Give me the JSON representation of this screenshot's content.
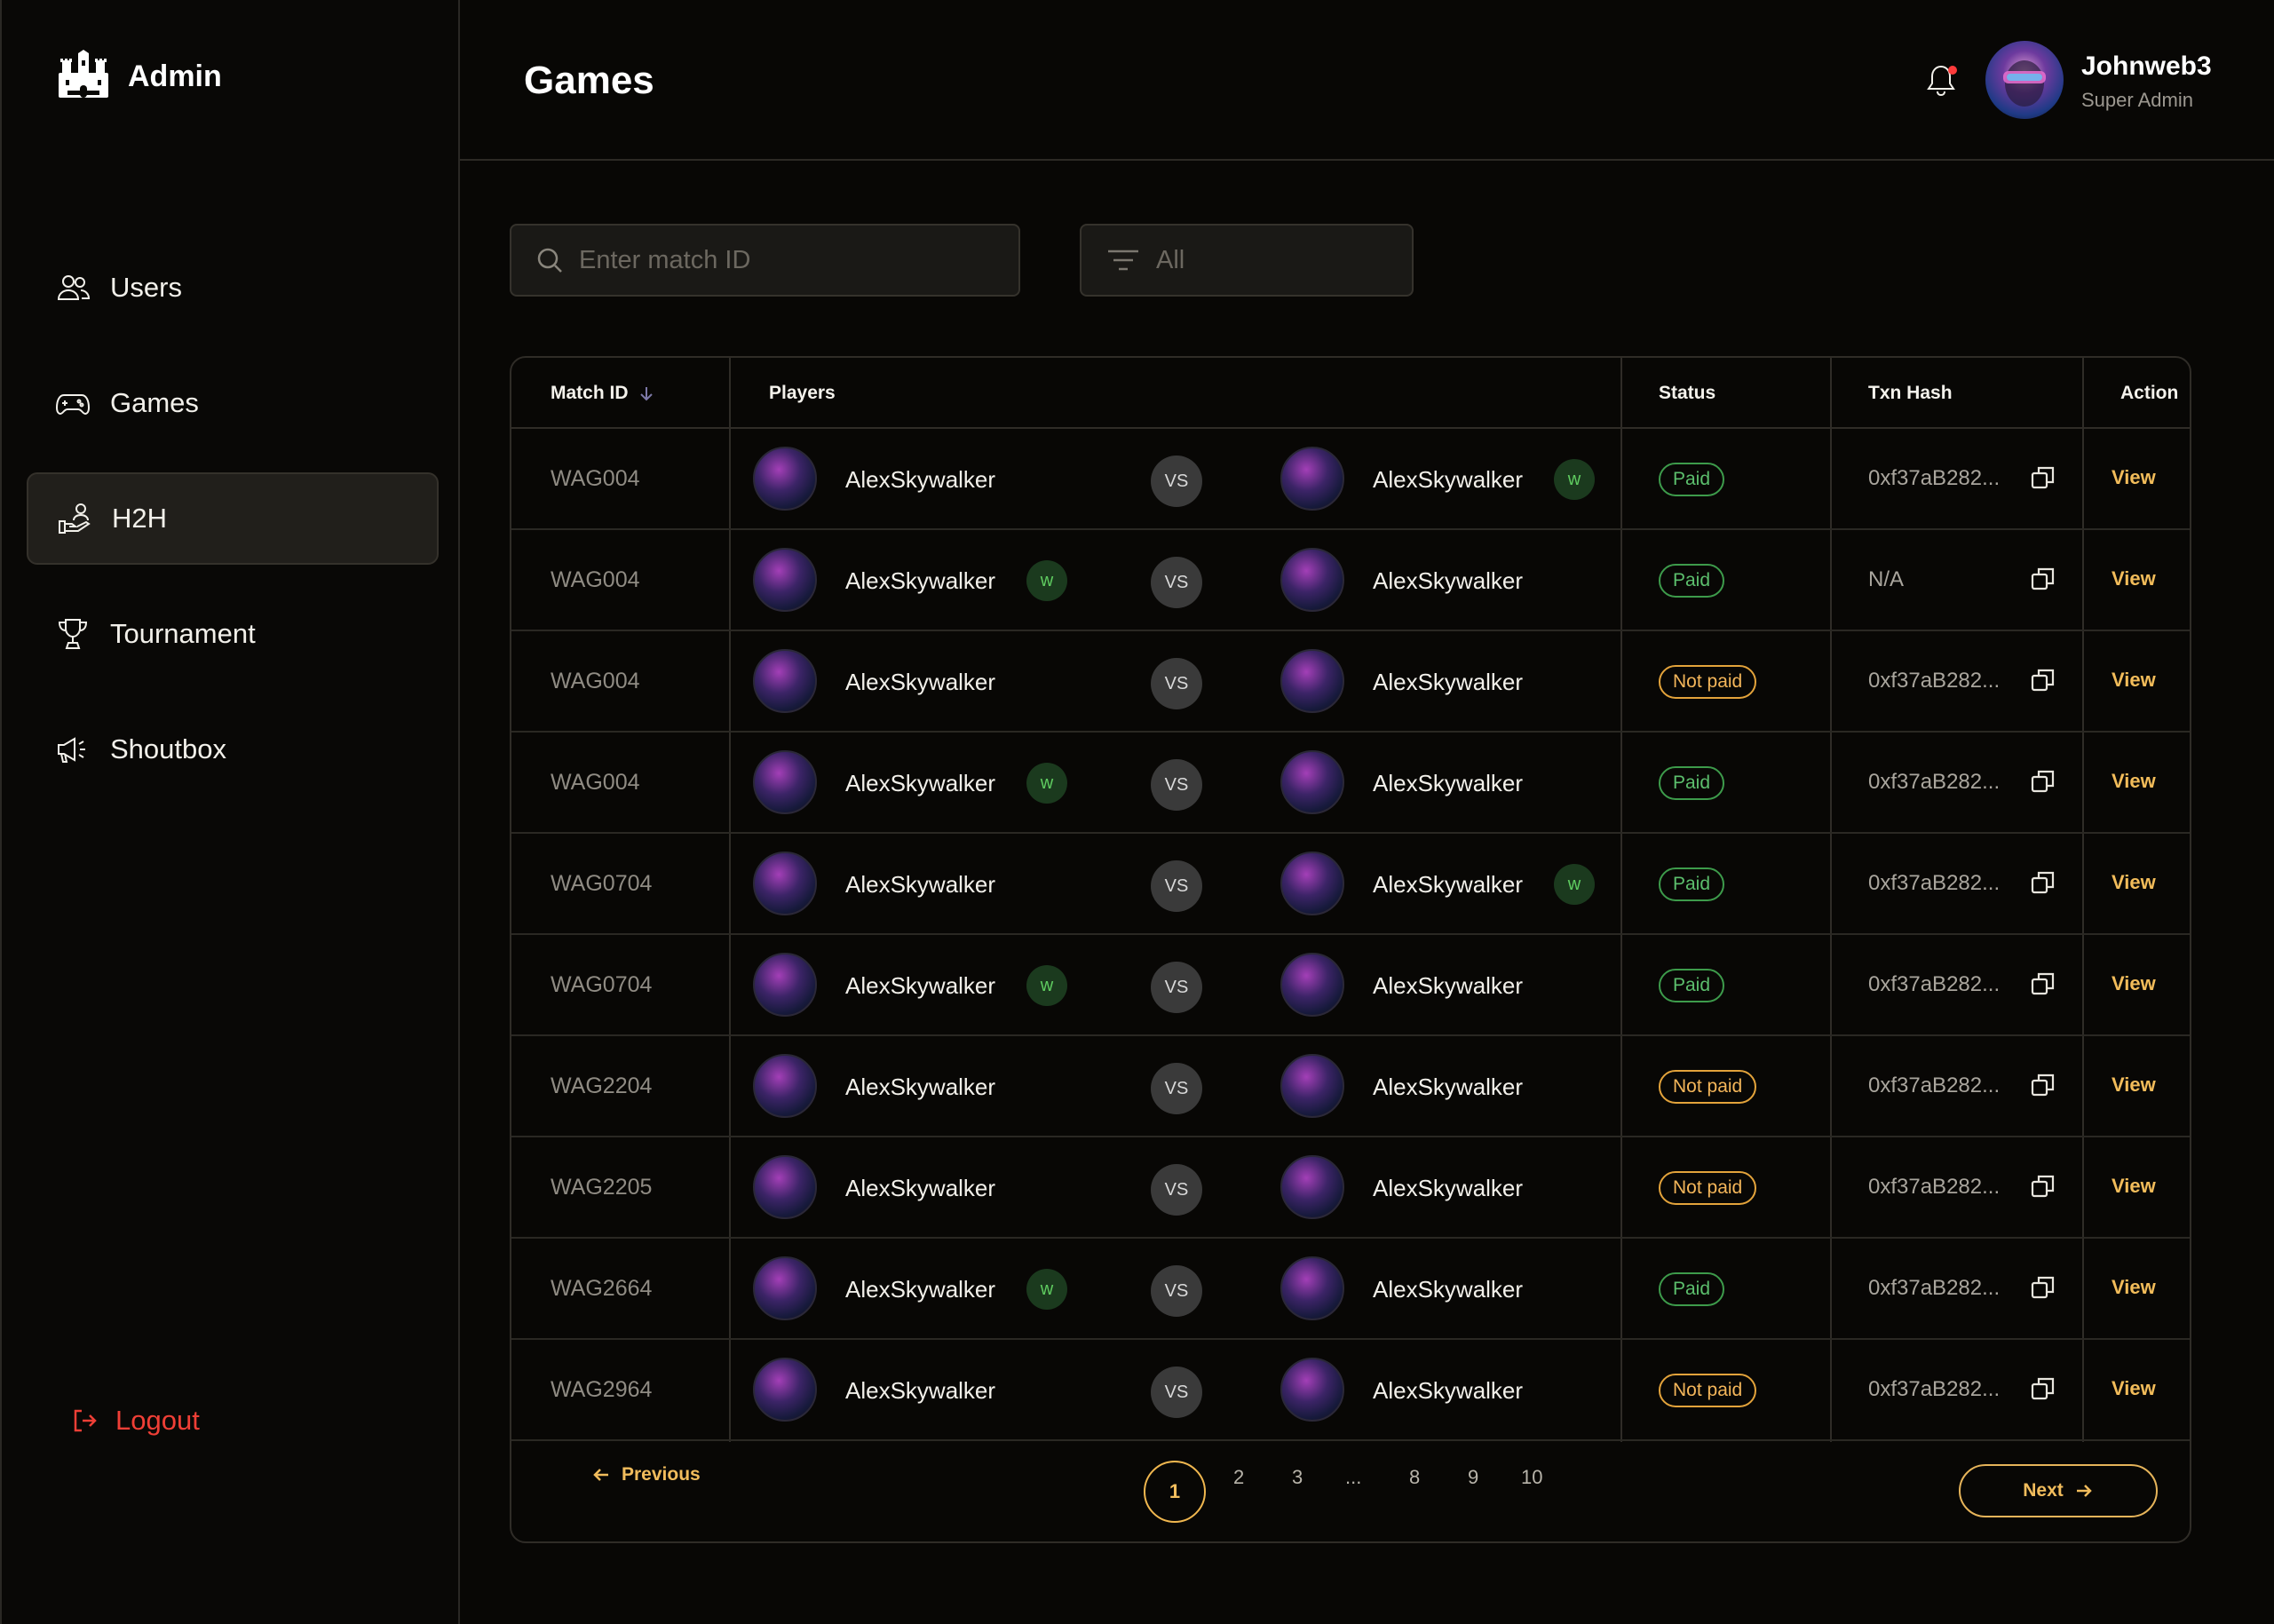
{
  "app": {
    "name": "Admin"
  },
  "header": {
    "title": "Games",
    "user_name": "Johnweb3",
    "user_role": "Super Admin"
  },
  "sidebar": {
    "items": [
      {
        "label": "Users",
        "icon": "users-icon"
      },
      {
        "label": "Games",
        "icon": "gamepad-icon"
      },
      {
        "label": "H2H",
        "icon": "hand-user-icon",
        "active": true
      },
      {
        "label": "Tournament",
        "icon": "trophy-icon"
      },
      {
        "label": "Shoutbox",
        "icon": "megaphone-icon"
      }
    ],
    "logout_label": "Logout"
  },
  "filters": {
    "search_placeholder": "Enter match ID",
    "status_value": "All"
  },
  "table": {
    "columns": [
      "Match ID",
      "Players",
      "Status",
      "Txn Hash",
      "Action"
    ],
    "vs_label": "VS",
    "winner_label": "w",
    "action_label": "View",
    "rows": [
      {
        "id": "WAG004",
        "p1": "AlexSkywalker",
        "p2": "AlexSkywalker",
        "winner": 2,
        "status": "Paid",
        "txn": "0xf37aB282..."
      },
      {
        "id": "WAG004",
        "p1": "AlexSkywalker",
        "p2": "AlexSkywalker",
        "winner": 1,
        "status": "Paid",
        "txn": "N/A"
      },
      {
        "id": "WAG004",
        "p1": "AlexSkywalker",
        "p2": "AlexSkywalker",
        "winner": 0,
        "status": "Not paid",
        "txn": "0xf37aB282..."
      },
      {
        "id": "WAG004",
        "p1": "AlexSkywalker",
        "p2": "AlexSkywalker",
        "winner": 1,
        "status": "Paid",
        "txn": "0xf37aB282..."
      },
      {
        "id": "WAG0704",
        "p1": "AlexSkywalker",
        "p2": "AlexSkywalker",
        "winner": 2,
        "status": "Paid",
        "txn": "0xf37aB282..."
      },
      {
        "id": "WAG0704",
        "p1": "AlexSkywalker",
        "p2": "AlexSkywalker",
        "winner": 1,
        "status": "Paid",
        "txn": "0xf37aB282..."
      },
      {
        "id": "WAG2204",
        "p1": "AlexSkywalker",
        "p2": "AlexSkywalker",
        "winner": 0,
        "status": "Not paid",
        "txn": "0xf37aB282..."
      },
      {
        "id": "WAG2205",
        "p1": "AlexSkywalker",
        "p2": "AlexSkywalker",
        "winner": 0,
        "status": "Not paid",
        "txn": "0xf37aB282..."
      },
      {
        "id": "WAG2664",
        "p1": "AlexSkywalker",
        "p2": "AlexSkywalker",
        "winner": 1,
        "status": "Paid",
        "txn": "0xf37aB282..."
      },
      {
        "id": "WAG2964",
        "p1": "AlexSkywalker",
        "p2": "AlexSkywalker",
        "winner": 0,
        "status": "Not paid",
        "txn": "0xf37aB282..."
      }
    ]
  },
  "pagination": {
    "previous_label": "Previous",
    "next_label": "Next",
    "pages": [
      "1",
      "2",
      "3",
      "...",
      "8",
      "9",
      "10"
    ],
    "current": "1"
  },
  "colors": {
    "accent": "#f2bc5a",
    "paid": "#5cbf6d",
    "not_paid": "#f4b65a",
    "logout": "#ef3f36"
  }
}
